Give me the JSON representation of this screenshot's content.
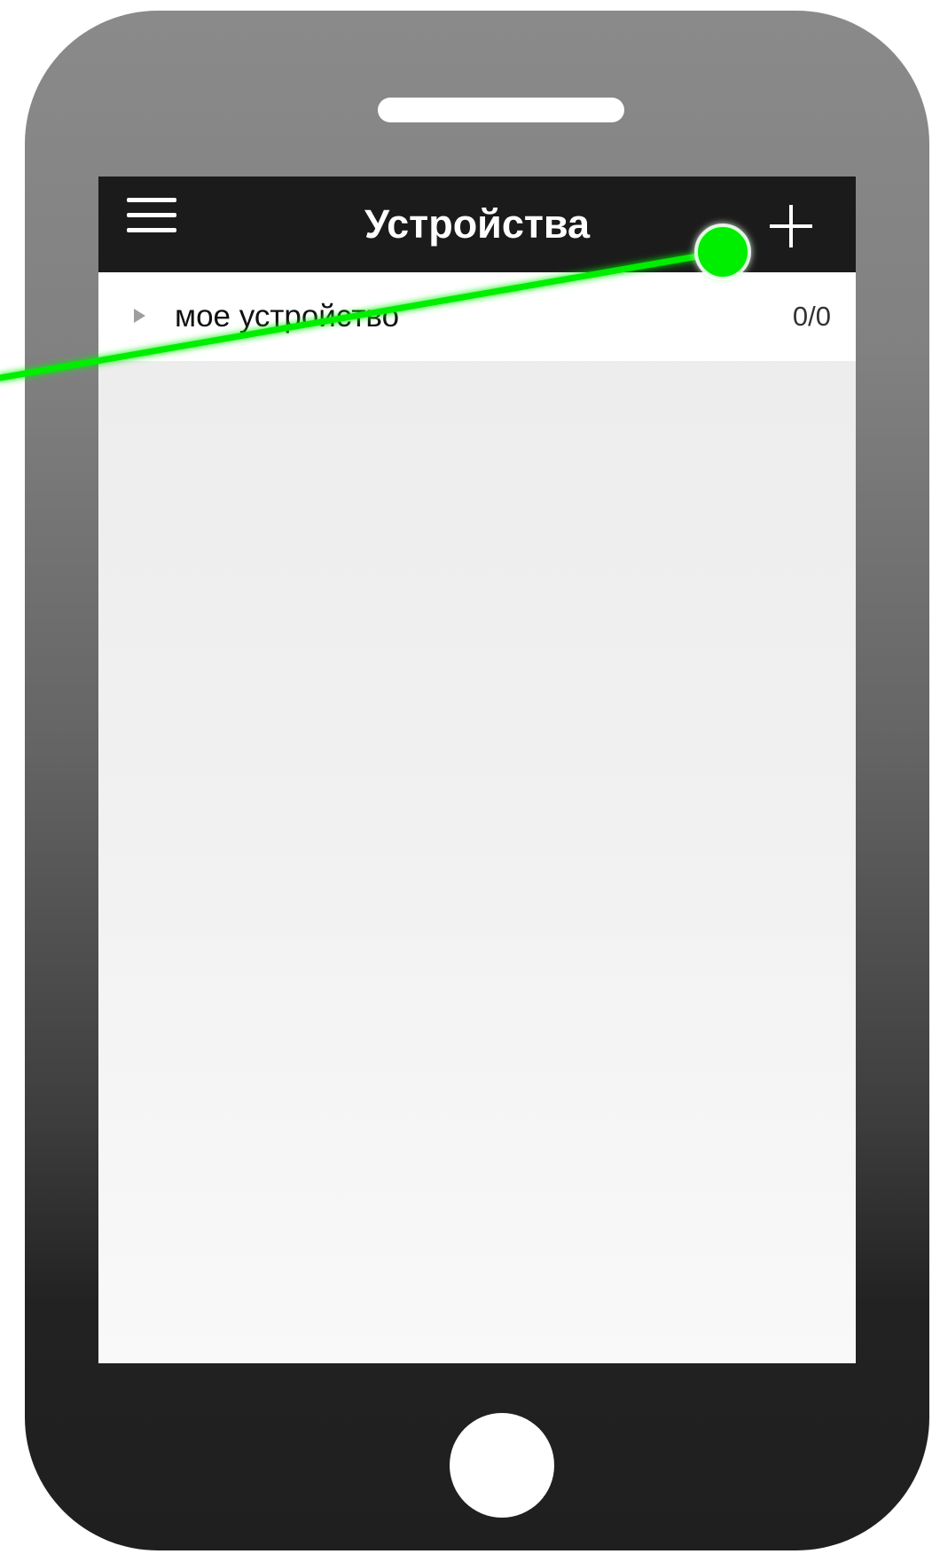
{
  "app_bar": {
    "title": "Устройства",
    "menu_icon": "hamburger-menu-icon",
    "add_icon": "plus-icon"
  },
  "device_list": [
    {
      "name": "мое устройство",
      "count": "0/0",
      "icon": "expand-triangle-icon"
    }
  ],
  "colors": {
    "app_bar": "#1b1b1b",
    "highlight": "#00ee00",
    "phone_body_top": "#8a8a8a",
    "phone_body_bottom": "#1f1f1f"
  }
}
